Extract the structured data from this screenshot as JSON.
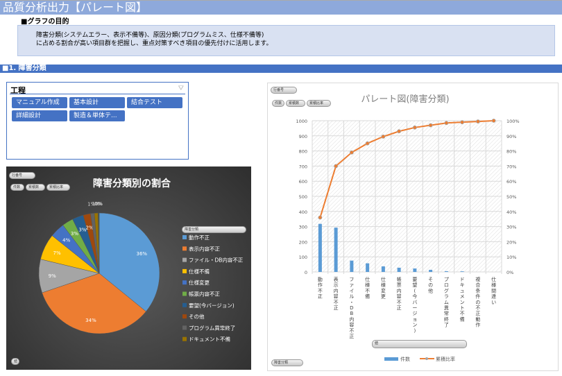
{
  "page_title": "品質分析出力【パレート図】",
  "purpose": {
    "heading": "■グラフの目的",
    "line1": "障害分類(システムエラー、表示不備等)、原因分類(プログラムミス、仕様不備等)",
    "line2": "に占める割合が高い項目群を把握し、重点対策すべき項目の優先付けに活用します。"
  },
  "section1": "■1. 障害分類",
  "slicer": {
    "title": "工程",
    "items": [
      "マニュアル作成",
      "基本設計",
      "結合テスト",
      "詳細設計",
      "製造＆単体テ..."
    ]
  },
  "pivot_buttons": {
    "row": "行番号",
    "b1": "件数",
    "b2": "累積数",
    "b3": "累積比率",
    "value": "値",
    "legend_field": "障害分類",
    "axis_field": "障害分類"
  },
  "colors": {
    "bar": "#5B9BD5",
    "line": "#ED7D31",
    "header": "#4472C4",
    "title": "#8EA9DB"
  },
  "chart_data": [
    {
      "type": "pie",
      "title": "障害分類別の割合",
      "legend_placement": "right",
      "categories": [
        "動作不正",
        "表示内容不正",
        "ファイル・DB内容不正",
        "仕様不備",
        "仕様変更",
        "帳票内容不正",
        "要望(今バージョン)",
        "その他",
        "プログラム異常終了",
        "ドキュメント不備",
        "複合条件の不正動作",
        "仕様間違い"
      ],
      "values": [
        36,
        34,
        9,
        7,
        4,
        3,
        3,
        2,
        1,
        1,
        0,
        0
      ],
      "labels": [
        "36%",
        "34%",
        "9%",
        "7%",
        "4%",
        "3%",
        "3%",
        "2%",
        "1%",
        "1%",
        "0%",
        "0%"
      ],
      "colors": [
        "#5B9BD5",
        "#ED7D31",
        "#A5A5A5",
        "#FFC000",
        "#4472C4",
        "#70AD47",
        "#255E91",
        "#9E480E",
        "#636363",
        "#997300",
        "#264478",
        "#43682B"
      ]
    },
    {
      "type": "bar+line",
      "title": "パレート図(障害分類)",
      "legend_placement": "bottom",
      "categories": [
        "動作不正",
        "表示内容不正",
        "ファイル・DB内容不正",
        "仕様不備",
        "仕様変更",
        "帳票内容不正",
        "要望(今バージョン)",
        "その他",
        "プログラム異常終了",
        "ドキュメント不備",
        "複合条件の不正動作",
        "仕様間違い"
      ],
      "series": [
        {
          "name": "件数",
          "type": "bar",
          "axis": "left",
          "values": [
            318,
            293,
            75,
            57,
            37,
            28,
            23,
            14,
            5,
            4,
            0,
            0
          ]
        },
        {
          "name": "累積比率",
          "type": "line",
          "axis": "right",
          "values": [
            36,
            70,
            79,
            85,
            89.5,
            93,
            95.5,
            97,
            98.5,
            99,
            99.5,
            100
          ]
        }
      ],
      "ylim": [
        0,
        1000
      ],
      "yticks": [
        "0",
        "100",
        "200",
        "300",
        "400",
        "500",
        "600",
        "700",
        "800",
        "900",
        "1000"
      ],
      "y2lim": [
        0,
        100
      ],
      "y2ticks": [
        "0%",
        "10%",
        "20%",
        "30%",
        "40%",
        "50%",
        "60%",
        "70%",
        "80%",
        "90%",
        "100%"
      ],
      "grid": true
    }
  ]
}
